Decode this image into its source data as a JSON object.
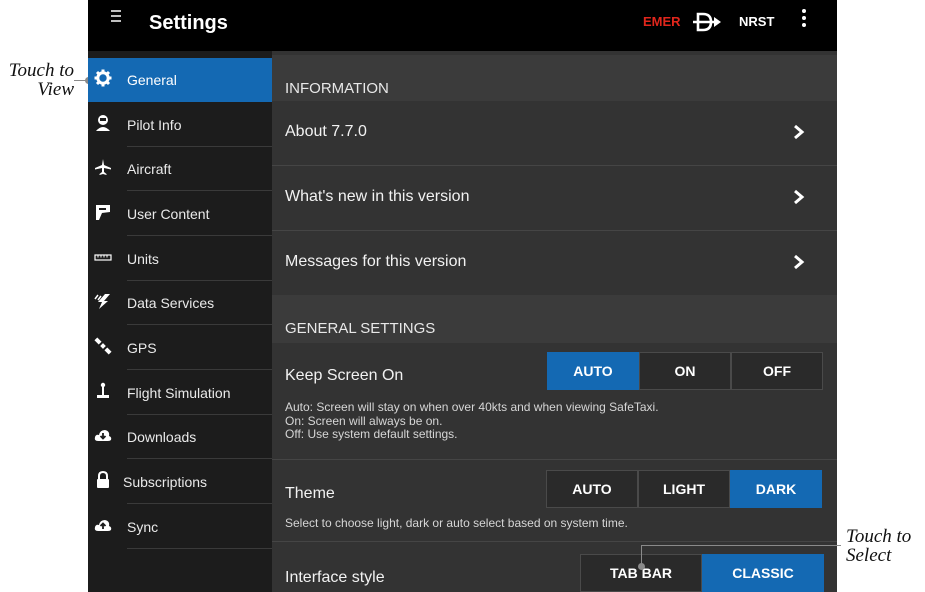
{
  "annotations": {
    "left": {
      "line1": "Touch to",
      "line2": "View"
    },
    "right": {
      "line1": "Touch to",
      "line2": "Select"
    }
  },
  "topbar": {
    "title": "Settings",
    "emer": "EMER",
    "nrst": "NRST",
    "icons": [
      "hamburger-icon",
      "direct-to-icon",
      "more-vertical-icon"
    ]
  },
  "sidebar": {
    "items": [
      {
        "label": "General",
        "icon": "gear-icon",
        "active": true
      },
      {
        "label": "Pilot Info",
        "icon": "pilot-icon"
      },
      {
        "label": "Aircraft",
        "icon": "airplane-icon"
      },
      {
        "label": "User Content",
        "icon": "user-content-icon"
      },
      {
        "label": "Units",
        "icon": "ruler-icon"
      },
      {
        "label": "Data Services",
        "icon": "data-services-icon"
      },
      {
        "label": "GPS",
        "icon": "satellite-icon"
      },
      {
        "label": "Flight Simulation",
        "icon": "joystick-icon"
      },
      {
        "label": "Downloads",
        "icon": "cloud-download-icon"
      },
      {
        "label": "Subscriptions",
        "icon": "lock-icon"
      },
      {
        "label": "Sync",
        "icon": "cloud-sync-icon"
      }
    ]
  },
  "information": {
    "header": "INFORMATION",
    "rows": [
      {
        "label": "About 7.7.0"
      },
      {
        "label": "What's new in this version"
      },
      {
        "label": "Messages for this version"
      }
    ]
  },
  "general_settings": {
    "header": "GENERAL SETTINGS",
    "keep_screen_on": {
      "label": "Keep Screen On",
      "options": [
        "AUTO",
        "ON",
        "OFF"
      ],
      "selected": "AUTO",
      "desc1": "Auto: Screen will stay on when over 40kts and when viewing SafeTaxi.",
      "desc2": "On: Screen will always be on.",
      "desc3": "Off: Use system default settings."
    },
    "theme": {
      "label": "Theme",
      "options": [
        "AUTO",
        "LIGHT",
        "DARK"
      ],
      "selected": "DARK",
      "desc": "Select to choose light, dark or auto select based on system time."
    },
    "interface_style": {
      "label": "Interface style",
      "options": [
        "TAB BAR",
        "CLASSIC"
      ],
      "selected": "CLASSIC"
    }
  },
  "colors": {
    "accent": "#1469b3",
    "emer": "#e1261c",
    "background": "#333333",
    "sidebar": "#1c1c1c"
  }
}
